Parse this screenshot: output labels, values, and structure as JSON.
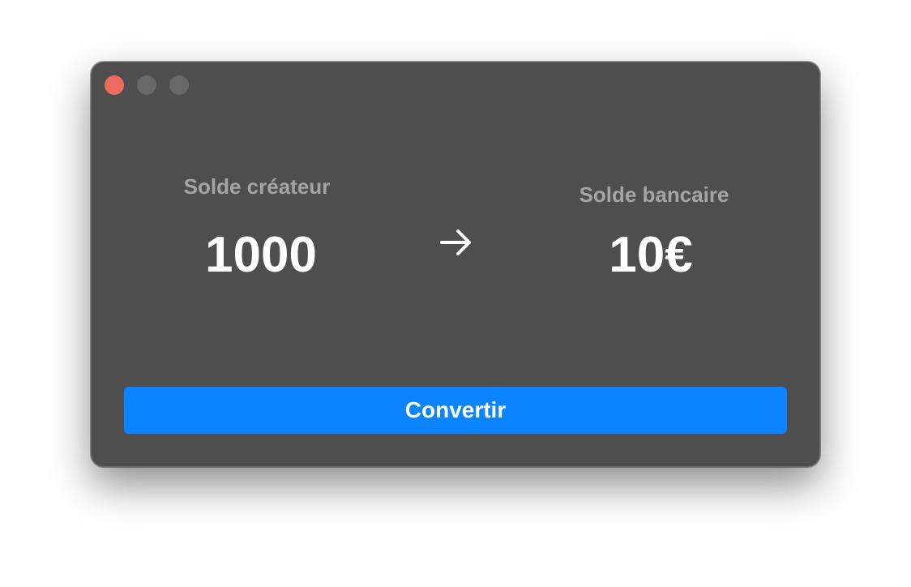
{
  "window": {
    "traffic_lights": {
      "close_color": "#ed6a5e",
      "minimize_color": "#686868",
      "maximize_color": "#686868"
    }
  },
  "conversion": {
    "source_label": "Solde créateur",
    "source_value": "1000",
    "arrow_icon": "arrow-right-icon",
    "target_label": "Solde bancaire",
    "target_value": "10€"
  },
  "actions": {
    "convert_label": "Convertir",
    "convert_color": "#0a84ff"
  }
}
